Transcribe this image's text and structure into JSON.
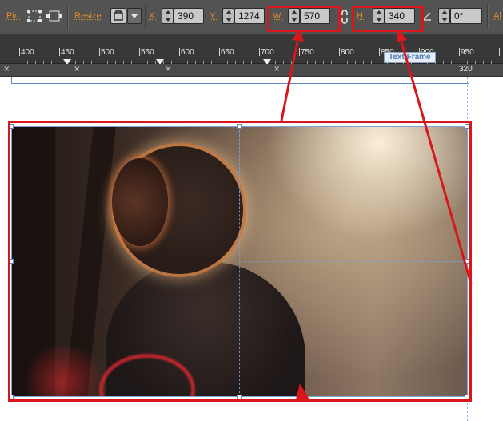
{
  "toolbar": {
    "pin_label": "Pin:",
    "resize_label": "Resize:",
    "x_label": "X:",
    "x_value": "390",
    "y_label": "Y:",
    "y_value": "1274",
    "w_label": "W:",
    "w_value": "570",
    "h_label": "H:",
    "h_value": "340",
    "angle_value": "0°",
    "align_label": "Al"
  },
  "ruler": {
    "labels": [
      "400",
      "450",
      "500",
      "550",
      "600",
      "650",
      "700",
      "750",
      "800",
      "850",
      "900",
      "950"
    ],
    "strip_readout": "320",
    "tooltip": "Text Frame",
    "close_marks": [
      "×",
      "×",
      "×",
      "×"
    ]
  },
  "colors": {
    "accent_label": "#e08a26",
    "callout_red": "#d9161b",
    "selection_blue": "#5a8bc4"
  },
  "icons": [
    "pin-icon",
    "resize-icon",
    "dropdown-arrow-icon",
    "spinner-icon",
    "chain-link-icon",
    "angle-icon"
  ]
}
